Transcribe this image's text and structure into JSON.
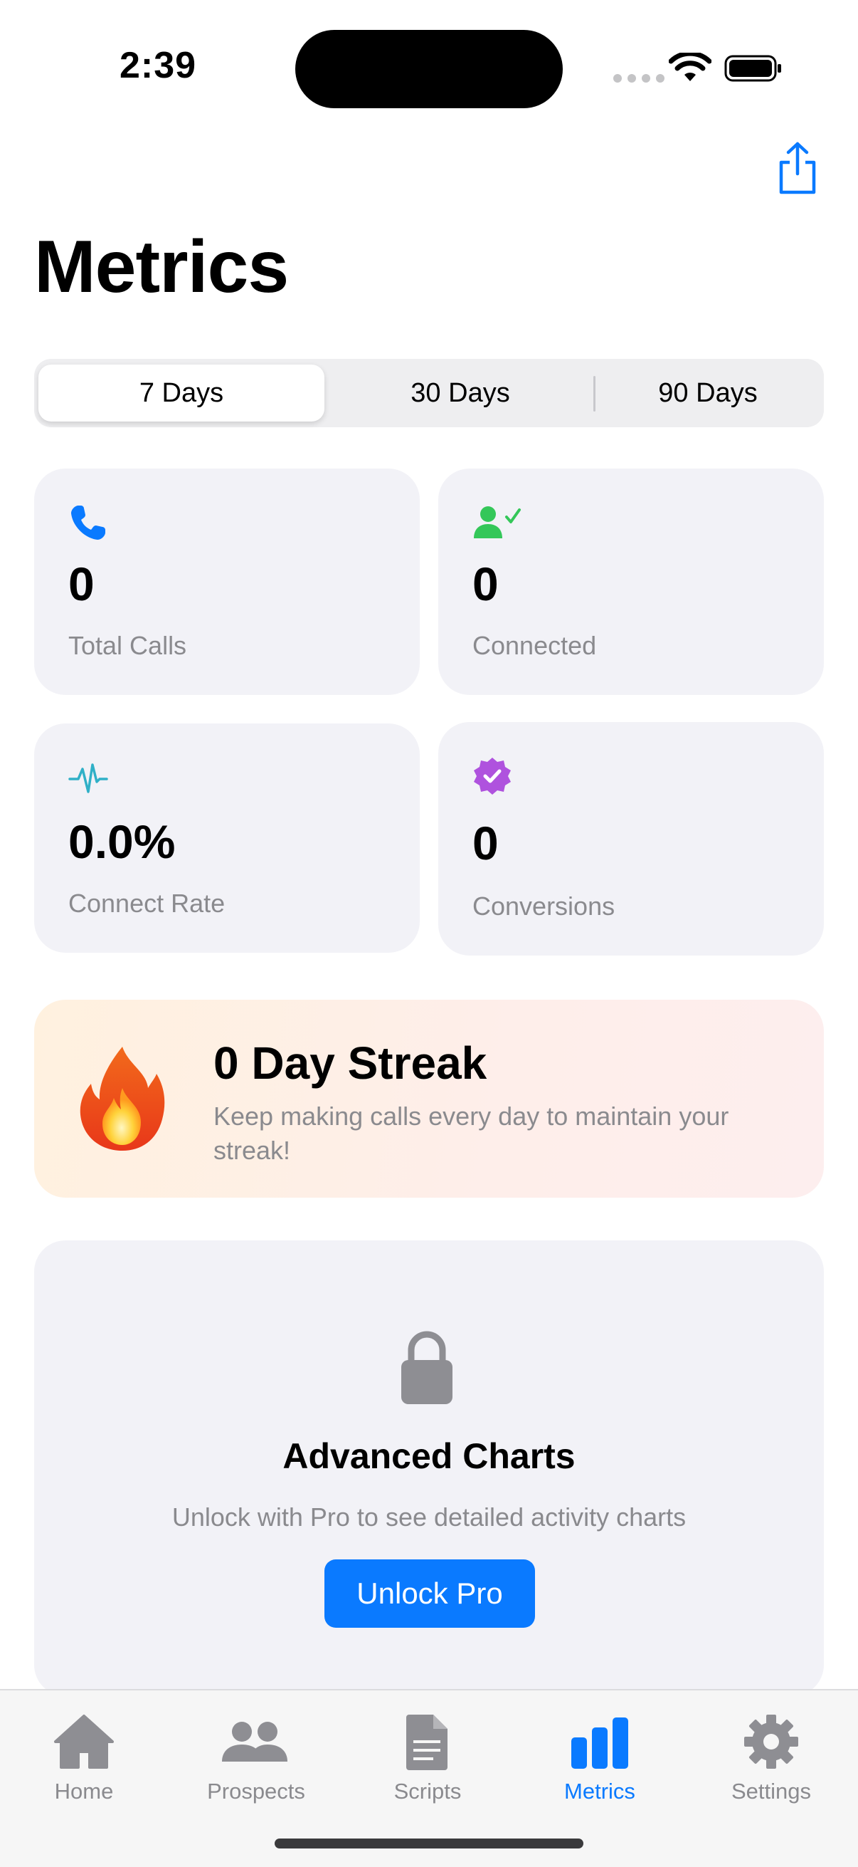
{
  "status_bar": {
    "time": "2:39"
  },
  "header": {
    "title": "Metrics",
    "share_icon": "share-icon"
  },
  "range_selector": {
    "options": [
      "7 Days",
      "30 Days",
      "90 Days"
    ],
    "selected": "7 Days"
  },
  "stats": [
    {
      "icon": "phone-icon",
      "value": "0",
      "label": "Total Calls",
      "color": "#0a7aff"
    },
    {
      "icon": "person-check-icon",
      "value": "0",
      "label": "Connected",
      "color": "#34c759"
    },
    {
      "icon": "waveform-icon",
      "value": "0.0%",
      "label": "Connect Rate",
      "color": "#30b0c7"
    },
    {
      "icon": "checkmark-seal-icon",
      "value": "0",
      "label": "Conversions",
      "color": "#af52de"
    }
  ],
  "streak": {
    "icon": "flame-icon",
    "title": "0 Day Streak",
    "subtitle": "Keep making calls every day to maintain your streak!"
  },
  "advanced_charts": {
    "icon": "lock-icon",
    "title": "Advanced Charts",
    "subtitle": "Unlock with Pro to see detailed activity charts",
    "button_label": "Unlock Pro"
  },
  "tab_bar": {
    "items": [
      {
        "label": "Home",
        "icon": "house-icon"
      },
      {
        "label": "Prospects",
        "icon": "people-icon"
      },
      {
        "label": "Scripts",
        "icon": "document-icon"
      },
      {
        "label": "Metrics",
        "icon": "bar-chart-icon"
      },
      {
        "label": "Settings",
        "icon": "gear-icon"
      }
    ],
    "active": "Metrics"
  },
  "colors": {
    "accent": "#0a7aff",
    "card_bg": "#f2f2f7",
    "secondary_text": "#8a8a8e"
  }
}
